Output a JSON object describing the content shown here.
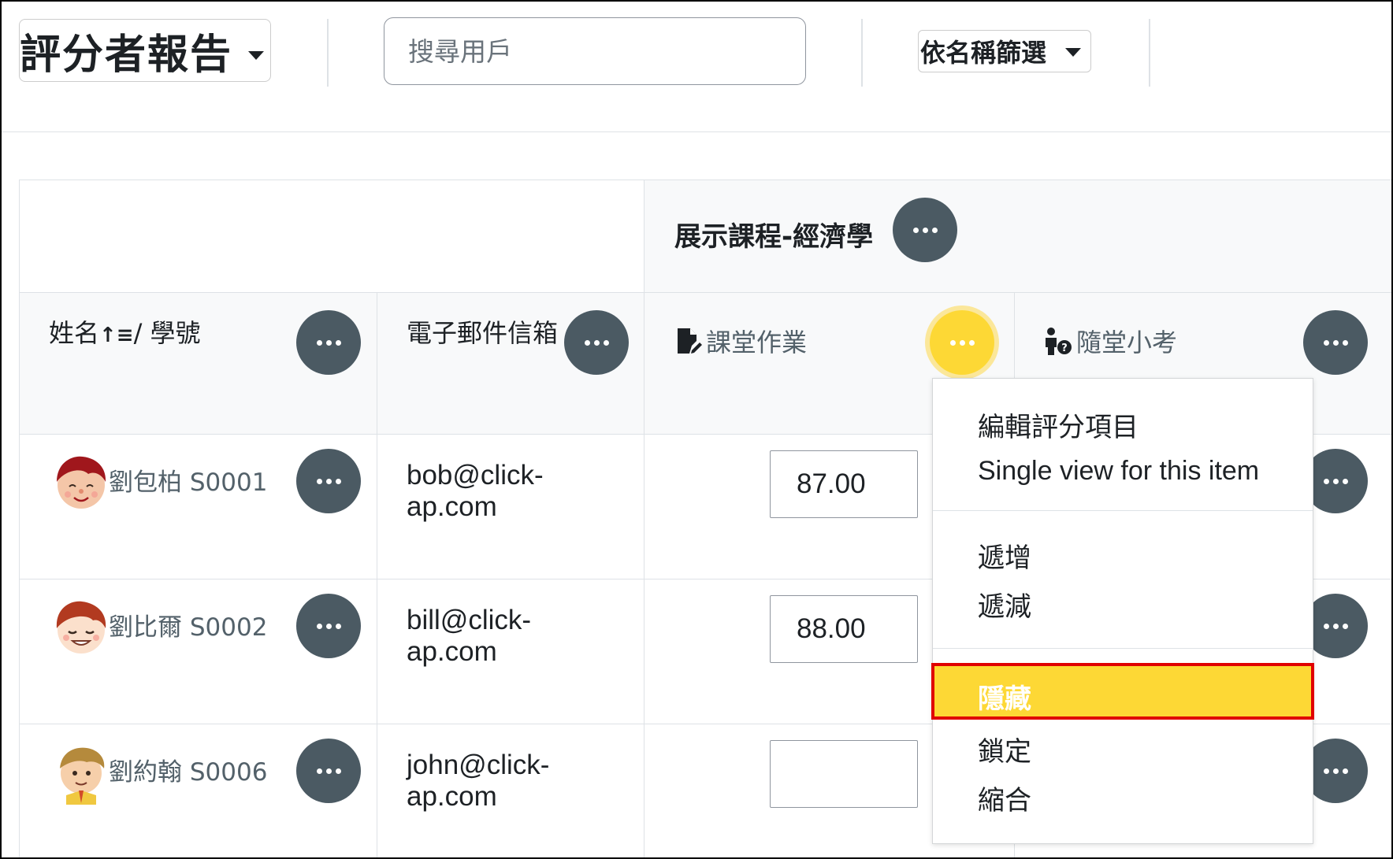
{
  "toolbar": {
    "report_selector": "評分者報告",
    "search_placeholder": "搜尋用戶",
    "name_filter": "依名稱篩選"
  },
  "table": {
    "category_title": "展示課程-經濟學",
    "columns": {
      "name": "姓名",
      "name_sep": "/ 學號",
      "email": "電子郵件信箱",
      "item1": "課堂作業",
      "item2": "隨堂小考"
    },
    "rows": [
      {
        "name": "劉包柏 S0001",
        "email": "bob@click-ap.com",
        "grade": "87.00"
      },
      {
        "name": "劉比爾 S0002",
        "email": "bill@click-ap.com",
        "grade": "88.00"
      },
      {
        "name": "劉約翰 S0006",
        "email": "john@click-ap.com",
        "grade": ""
      }
    ]
  },
  "menu": {
    "edit_item": "編輯評分項目",
    "single_view": "Single view for this item",
    "increase": "遞增",
    "decrease": "遞減",
    "hide": "隱藏",
    "lock": "鎖定",
    "collapse": "縮合"
  },
  "icons": {
    "more": "more-actions-icon",
    "sort": "sort-ascending-icon",
    "assignment": "assignment-icon",
    "quiz": "quiz-icon"
  },
  "colors": {
    "action_button": "#4b5a63",
    "active_button": "#fdd835",
    "highlight_border": "#e00000"
  }
}
